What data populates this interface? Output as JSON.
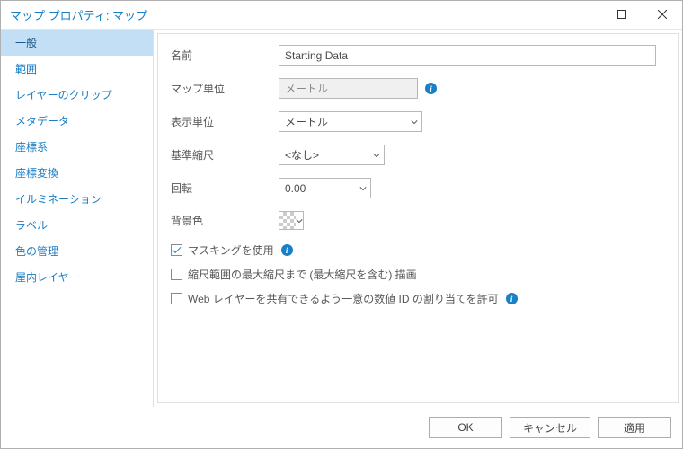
{
  "window": {
    "title": "マップ プロパティ: マップ"
  },
  "sidebar": {
    "items": [
      {
        "label": "一般",
        "selected": true
      },
      {
        "label": "範囲"
      },
      {
        "label": "レイヤーのクリップ"
      },
      {
        "label": "メタデータ"
      },
      {
        "label": "座標系"
      },
      {
        "label": "座標変換"
      },
      {
        "label": "イルミネーション"
      },
      {
        "label": "ラベル"
      },
      {
        "label": "色の管理"
      },
      {
        "label": "屋内レイヤー"
      }
    ]
  },
  "form": {
    "name_label": "名前",
    "name_value": "Starting Data",
    "map_units_label": "マップ単位",
    "map_units_value": "メートル",
    "display_units_label": "表示単位",
    "display_units_value": "メートル",
    "ref_scale_label": "基準縮尺",
    "ref_scale_value": "<なし>",
    "rotation_label": "回転",
    "rotation_value": "0.00",
    "bgcolor_label": "背景色",
    "chk_masking_label": "マスキングを使用",
    "chk_masking_checked": true,
    "chk_drawscale_label": "縮尺範囲の最大縮尺まで (最大縮尺を含む) 描画",
    "chk_drawscale_checked": false,
    "chk_webids_label": "Web レイヤーを共有できるよう一意の数値 ID の割り当てを許可",
    "chk_webids_checked": false
  },
  "buttons": {
    "ok": "OK",
    "cancel": "キャンセル",
    "apply": "適用"
  },
  "icons": {
    "info_glyph": "i"
  }
}
